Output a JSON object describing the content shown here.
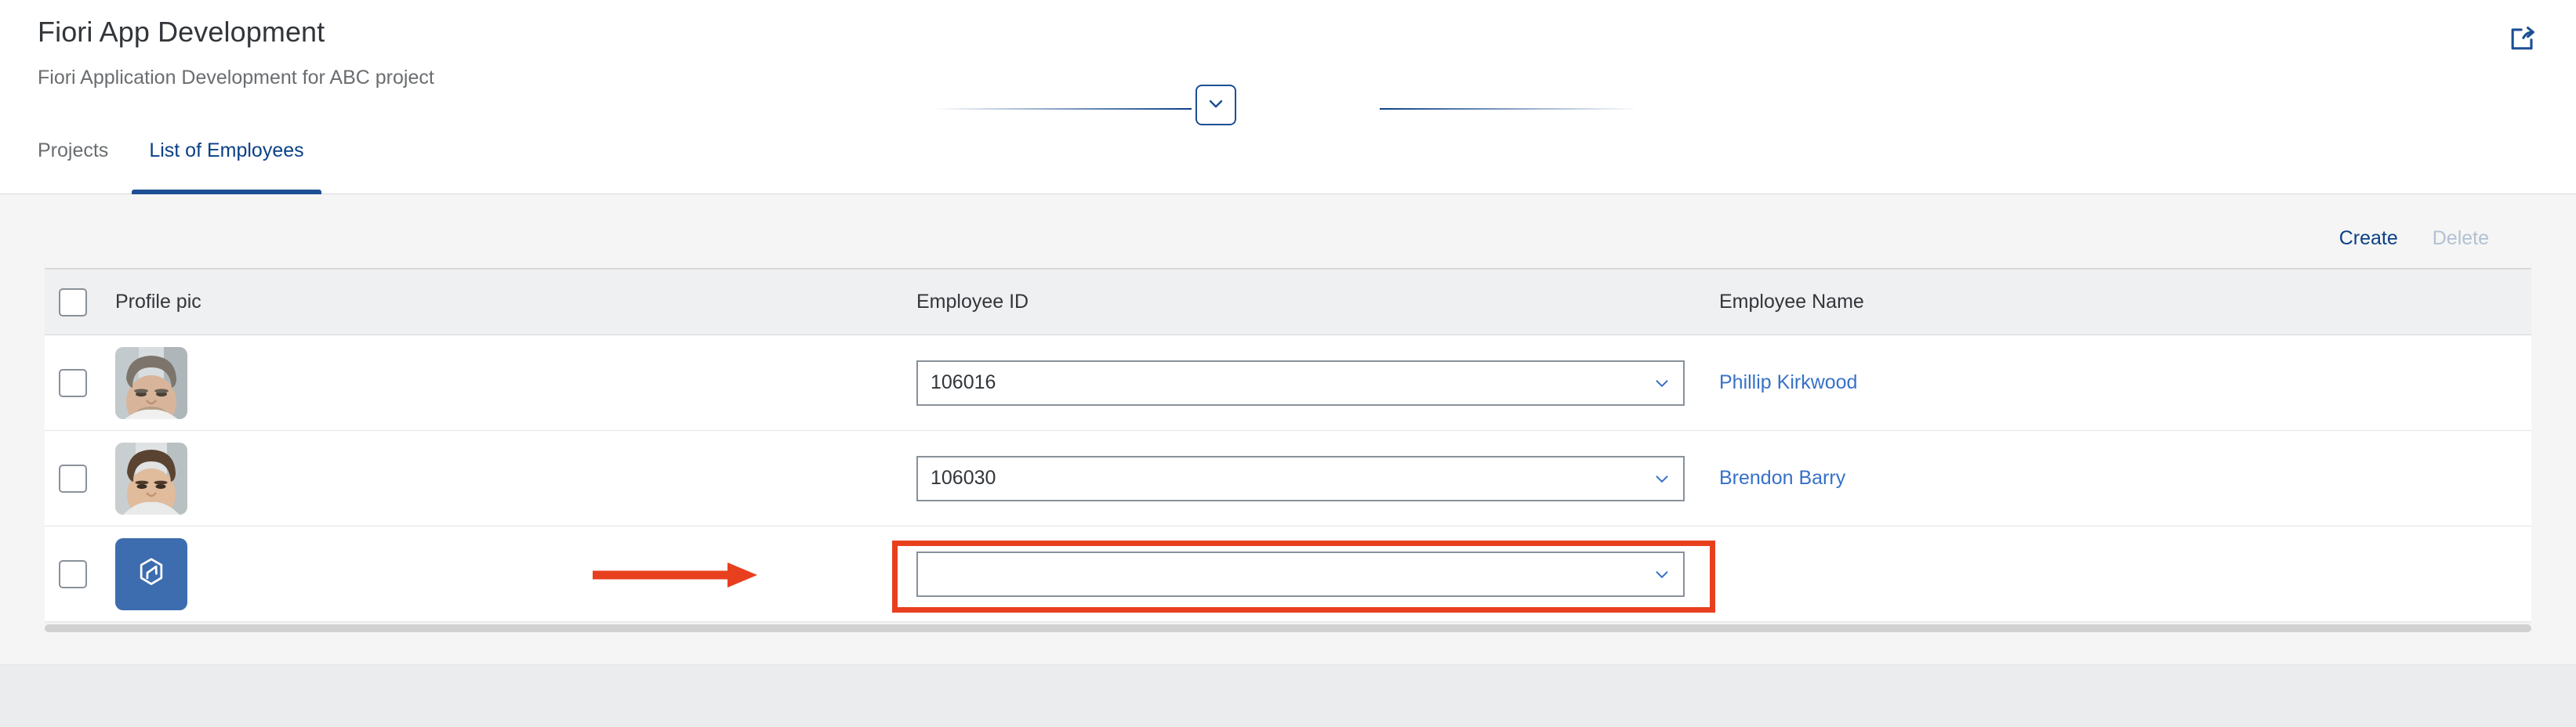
{
  "header": {
    "title": "Fiori App Development",
    "subtitle": "Fiori Application Development for ABC project",
    "share_icon": "share-export-icon",
    "collapse_icon": "chevron-down-icon"
  },
  "tabs": [
    {
      "label": "Projects",
      "active": false
    },
    {
      "label": "List of Employees",
      "active": true
    }
  ],
  "toolbar": {
    "create_label": "Create",
    "delete_label": "Delete"
  },
  "table": {
    "columns": [
      "Profile pic",
      "Employee ID",
      "Employee Name"
    ],
    "select_all_checkbox": false,
    "rows": [
      {
        "selected": false,
        "avatar_type": "photo",
        "avatar_name": "employee-photo-avatar",
        "employee_id": "106016",
        "employee_name": "Phillip Kirkwood",
        "dropdown_icon": "chevron-down-icon"
      },
      {
        "selected": false,
        "avatar_type": "photo",
        "avatar_name": "employee-photo-avatar",
        "employee_id": "106030",
        "employee_name": "Brendon Barry",
        "dropdown_icon": "chevron-down-icon"
      },
      {
        "selected": false,
        "avatar_type": "placeholder",
        "avatar_name": "product-placeholder-avatar",
        "employee_id": "",
        "employee_name": "",
        "dropdown_icon": "chevron-down-icon"
      }
    ]
  },
  "annotations": {
    "highlight_color": "#e8401f",
    "arrow_color": "#e8401f",
    "highlight_target": "empty-employee-id-combobox"
  },
  "colors": {
    "brand_blue": "#0a4086",
    "link_blue": "#3771c8",
    "avatar_blue": "#3d6daf",
    "disabled_blue": "#b3c1d4",
    "page_bg": "#f5f5f5",
    "header_row_bg": "#eff0f1"
  }
}
